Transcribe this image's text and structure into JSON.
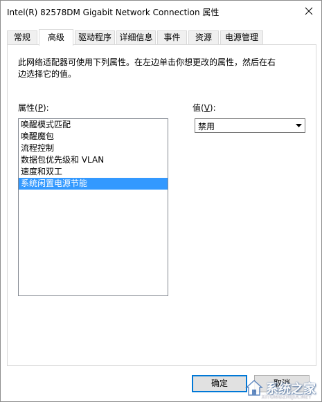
{
  "window": {
    "title": "Intel(R) 82578DM Gigabit Network Connection 属性"
  },
  "tabs": [
    {
      "label": "常规",
      "active": false
    },
    {
      "label": "高级",
      "active": true
    },
    {
      "label": "驱动程序",
      "active": false
    },
    {
      "label": "详细信息",
      "active": false
    },
    {
      "label": "事件",
      "active": false
    },
    {
      "label": "资源",
      "active": false
    },
    {
      "label": "电源管理",
      "active": false
    }
  ],
  "advanced": {
    "description": "此网络适配器可使用下列属性。在左边单击你想更改的属性，然后在右边选择它的值。",
    "property_label_prefix": "属性(",
    "property_label_key": "P",
    "property_label_suffix": "):",
    "value_label_prefix": "值(",
    "value_label_key": "V",
    "value_label_suffix": "):",
    "properties": [
      "唤醒模式匹配",
      "唤醒魔包",
      "流程控制",
      "数据包优先级和 VLAN",
      "速度和双工",
      "系统闲置电源节能"
    ],
    "selected_index": 5,
    "value_selected": "禁用"
  },
  "buttons": {
    "ok_label": "确定",
    "cancel_label": "取消"
  },
  "watermark": {
    "text": "系统之家",
    "url": "XITONGZHIJIA.NET"
  },
  "colors": {
    "selection": "#3399ff",
    "default_button_border": "#0078d7"
  }
}
